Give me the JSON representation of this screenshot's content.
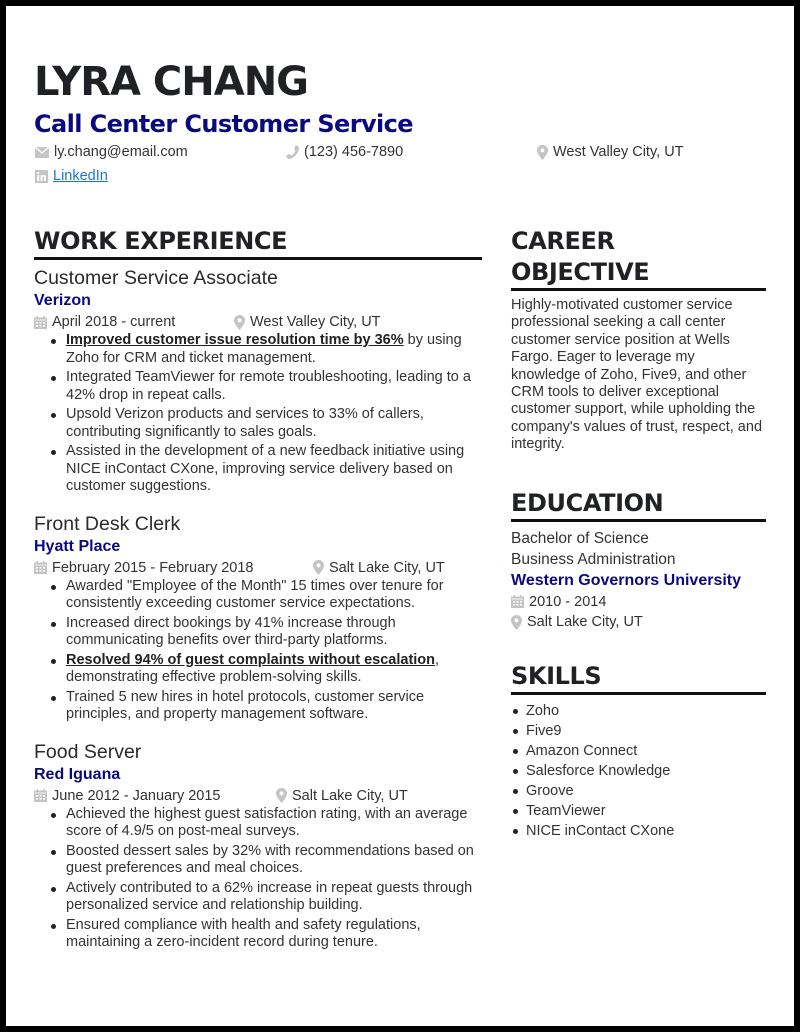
{
  "header": {
    "name": "LYRA CHANG",
    "title": "Call Center Customer Service",
    "contact": {
      "email": "ly.chang@email.com",
      "phone": "(123) 456-7890",
      "location": "West Valley City, UT",
      "linkedin_label": "LinkedIn"
    }
  },
  "icons": {
    "email": "envelope-icon",
    "phone": "phone-icon",
    "location": "map-pin-icon",
    "linkedin": "linkedin-icon",
    "date": "calendar-icon"
  },
  "colors": {
    "accent": "#0a0a80",
    "link": "#1a73e8",
    "icon": "#bdbdbd",
    "heading": "#1f2124"
  },
  "work": {
    "heading": "WORK EXPERIENCE",
    "jobs": [
      {
        "title": "Customer Service Associate",
        "company": "Verizon",
        "dates": "April 2018 - current",
        "location": "West Valley City, UT",
        "bullets": [
          {
            "highlight": "Improved customer issue resolution time by 36%",
            "text": " by using Zoho for CRM and ticket management."
          },
          {
            "highlight": "",
            "text": "Integrated TeamViewer for remote troubleshooting, leading to a 42% drop in repeat calls."
          },
          {
            "highlight": "",
            "text": "Upsold Verizon products and services to 33% of callers, contributing significantly to sales goals."
          },
          {
            "highlight": "",
            "text": "Assisted in the development of a new feedback initiative using NICE inContact CXone, improving service delivery based on customer suggestions."
          }
        ]
      },
      {
        "title": "Front Desk Clerk",
        "company": "Hyatt Place",
        "dates": "February 2015 - February 2018",
        "location": "Salt Lake City, UT",
        "bullets": [
          {
            "highlight": "",
            "text": "Awarded \"Employee of the Month\" 15 times over tenure for consistently exceeding customer service expectations."
          },
          {
            "highlight": "",
            "text": "Increased direct bookings by 41% increase through communicating benefits over third-party platforms."
          },
          {
            "highlight": "Resolved 94% of guest complaints without escalation",
            "text": ", demonstrating effective problem-solving skills."
          },
          {
            "highlight": "",
            "text": "Trained 5 new hires in hotel protocols, customer service principles, and property management software."
          }
        ]
      },
      {
        "title": "Food Server",
        "company": "Red Iguana",
        "dates": "June 2012 - January 2015",
        "location": "Salt Lake City, UT",
        "bullets": [
          {
            "highlight": "",
            "text": "Achieved the highest guest satisfaction rating, with an average score of 4.9/5 on post-meal surveys."
          },
          {
            "highlight": "",
            "text": "Boosted dessert sales by 32% with recommendations based on guest preferences and meal choices."
          },
          {
            "highlight": "",
            "text": "Actively contributed to a 62% increase in repeat guests through personalized service and relationship building."
          },
          {
            "highlight": "",
            "text": "Ensured compliance with health and safety regulations, maintaining a zero-incident record during tenure."
          }
        ]
      }
    ]
  },
  "objective": {
    "heading_line1": "CAREER",
    "heading_line2": "OBJECTIVE",
    "text": "Highly-motivated customer service professional seeking a call center customer service position at Wells Fargo. Eager to leverage my knowledge of Zoho, Five9, and other CRM tools to deliver exceptional customer support, while upholding the company's values of trust, respect, and integrity."
  },
  "education": {
    "heading": "EDUCATION",
    "degree": "Bachelor of Science",
    "field": "Business Administration",
    "school": "Western Governors University",
    "dates": "2010 - 2014",
    "location": "Salt Lake City, UT"
  },
  "skills": {
    "heading": "SKILLS",
    "items": [
      "Zoho",
      "Five9",
      "Amazon Connect",
      "Salesforce Knowledge",
      "Groove",
      "TeamViewer",
      "NICE inContact CXone"
    ]
  }
}
